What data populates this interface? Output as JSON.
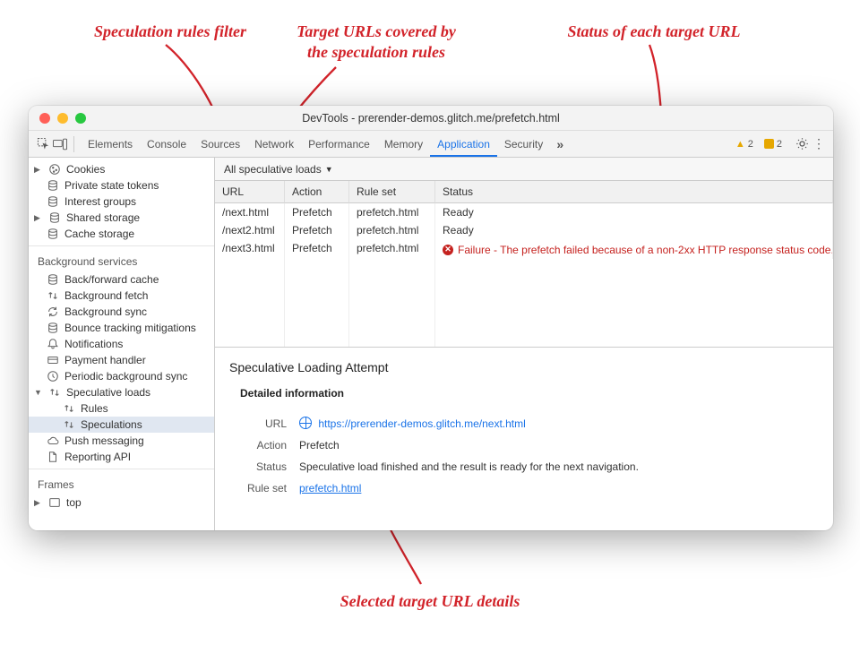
{
  "window": {
    "title": "DevTools - prerender-demos.glitch.me/prefetch.html"
  },
  "tabs": {
    "items": [
      "Elements",
      "Console",
      "Sources",
      "Network",
      "Performance",
      "Memory",
      "Application",
      "Security"
    ],
    "active": "Application",
    "warn_count": "2",
    "info_count": "2"
  },
  "sidebar": {
    "storage": [
      {
        "icon": "cookies",
        "label": "Cookies",
        "expandable": true
      },
      {
        "icon": "db",
        "label": "Private state tokens"
      },
      {
        "icon": "db",
        "label": "Interest groups"
      },
      {
        "icon": "db",
        "label": "Shared storage",
        "expandable": true
      },
      {
        "icon": "db",
        "label": "Cache storage"
      }
    ],
    "bg_title": "Background services",
    "bg": [
      {
        "icon": "db",
        "label": "Back/forward cache"
      },
      {
        "icon": "updown",
        "label": "Background fetch"
      },
      {
        "icon": "sync",
        "label": "Background sync"
      },
      {
        "icon": "db",
        "label": "Bounce tracking mitigations"
      },
      {
        "icon": "bell",
        "label": "Notifications"
      },
      {
        "icon": "card",
        "label": "Payment handler"
      },
      {
        "icon": "clock",
        "label": "Periodic background sync"
      },
      {
        "icon": "updown",
        "label": "Speculative loads",
        "expandable": true,
        "expanded": true,
        "children": [
          {
            "icon": "updown",
            "label": "Rules"
          },
          {
            "icon": "updown",
            "label": "Speculations",
            "selected": true
          }
        ]
      },
      {
        "icon": "cloud",
        "label": "Push messaging"
      },
      {
        "icon": "doc",
        "label": "Reporting API"
      }
    ],
    "frames_title": "Frames",
    "frames": [
      {
        "icon": "frame",
        "label": "top",
        "expandable": true
      }
    ]
  },
  "filter": {
    "label": "All speculative loads"
  },
  "table": {
    "headers": {
      "url": "URL",
      "action": "Action",
      "ruleset": "Rule set",
      "status": "Status"
    },
    "rows": [
      {
        "url": "/next.html",
        "action": "Prefetch",
        "ruleset": "prefetch.html",
        "status": "Ready",
        "error": false
      },
      {
        "url": "/next2.html",
        "action": "Prefetch",
        "ruleset": "prefetch.html",
        "status": "Ready",
        "error": false
      },
      {
        "url": "/next3.html",
        "action": "Prefetch",
        "ruleset": "prefetch.html",
        "status": "Failure - The prefetch failed because of a non-2xx HTTP response status code.",
        "error": true
      }
    ]
  },
  "detail": {
    "heading": "Speculative Loading Attempt",
    "subheading": "Detailed information",
    "url_label": "URL",
    "url_value": "https://prerender-demos.glitch.me/next.html",
    "action_label": "Action",
    "action_value": "Prefetch",
    "status_label": "Status",
    "status_value": "Speculative load finished and the result is ready for the next navigation.",
    "ruleset_label": "Rule set",
    "ruleset_value": "prefetch.html"
  },
  "annotations": {
    "a1": "Speculation rules filter",
    "a2": "Target URLs covered by\nthe speculation rules",
    "a3": "Status of each target URL",
    "a4": "Selected target URL details"
  }
}
